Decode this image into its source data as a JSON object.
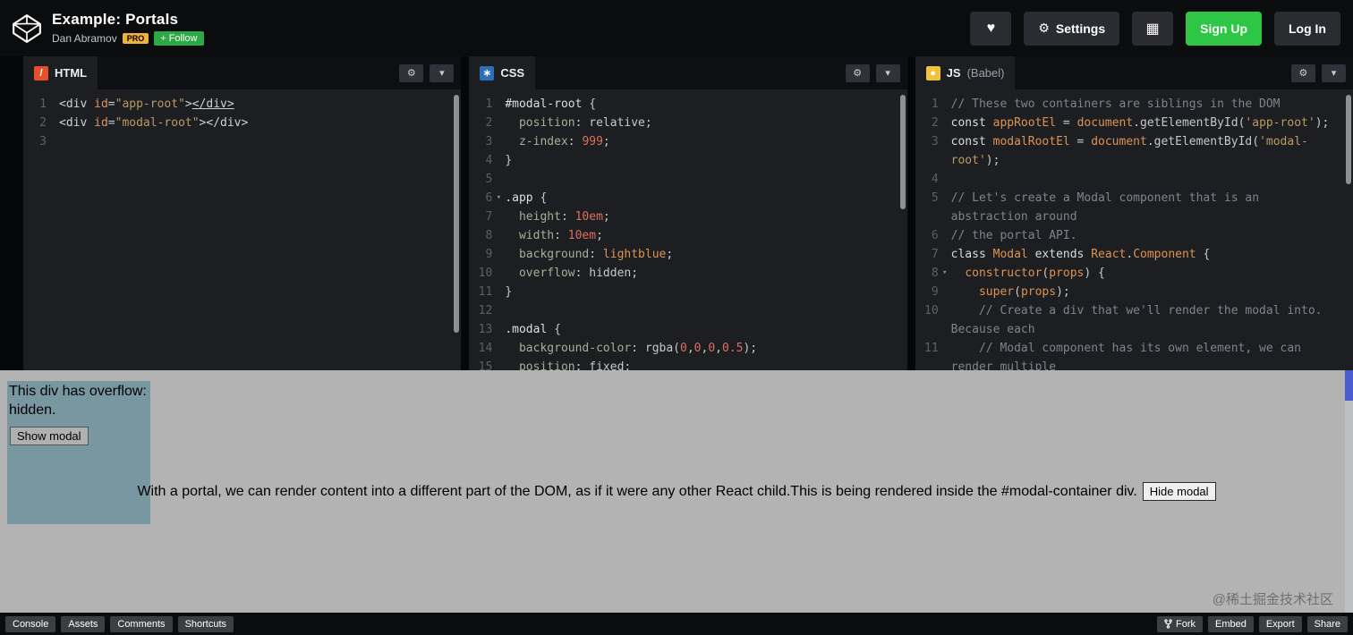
{
  "header": {
    "title": "Example: Portals",
    "author": "Dan Abramov",
    "pro_badge": "PRO",
    "follow_label": "+ Follow",
    "settings_label": "Settings",
    "sign_up_label": "Sign Up",
    "log_in_label": "Log In"
  },
  "icons": {
    "gear": "⚙",
    "chevron": "▾",
    "heart": "♥",
    "grid": "▦",
    "fold": "▾"
  },
  "colors": {
    "accent_green": "#2dc645",
    "follow_green": "#2aa945",
    "pro_gold": "#efb13a",
    "editor_bg": "#1d1e22",
    "preview_bg": "#b3b3b3",
    "app_box": "#7997a1",
    "preview_scroll_thumb": "#4a5ad0"
  },
  "editors": [
    {
      "name": "html",
      "label": "HTML",
      "sublabel": "",
      "icon_char": "/",
      "icon_color": "#e4502e",
      "lines": [
        {
          "num": "1",
          "tokens": [
            [
              "tag",
              "<div"
            ],
            [
              "pln",
              " "
            ],
            [
              "attr",
              "id"
            ],
            [
              "pun",
              "="
            ],
            [
              "str",
              "\"app-root\""
            ],
            [
              "tag",
              ">"
            ],
            [
              "tag u",
              "</div>"
            ]
          ]
        },
        {
          "num": "2",
          "tokens": [
            [
              "tag",
              "<div"
            ],
            [
              "pln",
              " "
            ],
            [
              "attr",
              "id"
            ],
            [
              "pun",
              "="
            ],
            [
              "str",
              "\"modal-root\""
            ],
            [
              "tag",
              ">"
            ],
            [
              "tag",
              "</div>"
            ]
          ]
        },
        {
          "num": "3",
          "tokens": []
        }
      ]
    },
    {
      "name": "css",
      "label": "CSS",
      "sublabel": "",
      "icon_char": "∗",
      "icon_color": "#2e6fba",
      "lines": [
        {
          "num": "1",
          "tokens": [
            [
              "sel",
              "#modal-root"
            ],
            [
              "pln",
              " {"
            ]
          ]
        },
        {
          "num": "2",
          "tokens": [
            [
              "pln",
              "  "
            ],
            [
              "prop",
              "position"
            ],
            [
              "pln",
              ": "
            ],
            [
              "val",
              "relative"
            ],
            [
              "pln",
              ";"
            ]
          ]
        },
        {
          "num": "3",
          "tokens": [
            [
              "pln",
              "  "
            ],
            [
              "prop",
              "z-index"
            ],
            [
              "pln",
              ": "
            ],
            [
              "num",
              "999"
            ],
            [
              "pln",
              ";"
            ]
          ]
        },
        {
          "num": "4",
          "tokens": [
            [
              "pln",
              "}"
            ]
          ]
        },
        {
          "num": "5",
          "tokens": []
        },
        {
          "num": "6",
          "fold": true,
          "tokens": [
            [
              "sel",
              ".app"
            ],
            [
              "pln",
              " {"
            ]
          ]
        },
        {
          "num": "7",
          "tokens": [
            [
              "pln",
              "  "
            ],
            [
              "prop",
              "height"
            ],
            [
              "pln",
              ": "
            ],
            [
              "num",
              "10em"
            ],
            [
              "pln",
              ";"
            ]
          ]
        },
        {
          "num": "8",
          "tokens": [
            [
              "pln",
              "  "
            ],
            [
              "prop",
              "width"
            ],
            [
              "pln",
              ": "
            ],
            [
              "num",
              "10em"
            ],
            [
              "pln",
              ";"
            ]
          ]
        },
        {
          "num": "9",
          "tokens": [
            [
              "pln",
              "  "
            ],
            [
              "prop",
              "background"
            ],
            [
              "pln",
              ": "
            ],
            [
              "id",
              "lightblue"
            ],
            [
              "pln",
              ";"
            ]
          ]
        },
        {
          "num": "10",
          "tokens": [
            [
              "pln",
              "  "
            ],
            [
              "prop",
              "overflow"
            ],
            [
              "pln",
              ": "
            ],
            [
              "val",
              "hidden"
            ],
            [
              "pln",
              ";"
            ]
          ]
        },
        {
          "num": "11",
          "tokens": [
            [
              "pln",
              "}"
            ]
          ]
        },
        {
          "num": "12",
          "tokens": []
        },
        {
          "num": "13",
          "tokens": [
            [
              "sel",
              ".modal"
            ],
            [
              "pln",
              " {"
            ]
          ]
        },
        {
          "num": "14",
          "tokens": [
            [
              "pln",
              "  "
            ],
            [
              "prop",
              "background-color"
            ],
            [
              "pln",
              ": "
            ],
            [
              "pln",
              "rgba("
            ],
            [
              "num",
              "0"
            ],
            [
              "pln",
              ","
            ],
            [
              "num",
              "0"
            ],
            [
              "pln",
              ","
            ],
            [
              "num",
              "0"
            ],
            [
              "pln",
              ","
            ],
            [
              "num",
              "0.5"
            ],
            [
              "pln",
              ");"
            ]
          ]
        },
        {
          "num": "15",
          "tokens": [
            [
              "pln",
              "  "
            ],
            [
              "prop",
              "position"
            ],
            [
              "pln",
              ": "
            ],
            [
              "val",
              "fixed"
            ],
            [
              "pln",
              ";"
            ]
          ]
        }
      ]
    },
    {
      "name": "js",
      "label": "JS",
      "sublabel": "(Babel)",
      "icon_char": "●",
      "icon_color": "#f0c33c",
      "lines": [
        {
          "num": "1",
          "tokens": [
            [
              "cmt",
              "// These two containers are siblings in the DOM"
            ]
          ]
        },
        {
          "num": "2",
          "tokens": [
            [
              "kw",
              "const"
            ],
            [
              "pln",
              " "
            ],
            [
              "id",
              "appRootEl"
            ],
            [
              "pln",
              " = "
            ],
            [
              "id",
              "document"
            ],
            [
              "pln",
              "."
            ],
            [
              "pln",
              "getElementById"
            ],
            [
              "pln",
              "("
            ],
            [
              "str",
              "'app-root'"
            ],
            [
              "pln",
              ");"
            ]
          ]
        },
        {
          "num": "3",
          "tokens": [
            [
              "kw",
              "const"
            ],
            [
              "pln",
              " "
            ],
            [
              "id",
              "modalRootEl"
            ],
            [
              "pln",
              " = "
            ],
            [
              "id",
              "document"
            ],
            [
              "pln",
              "."
            ],
            [
              "pln",
              "getElementById"
            ],
            [
              "pln",
              "("
            ],
            [
              "str",
              "'modal-"
            ]
          ]
        },
        {
          "num": "",
          "tokens": [
            [
              "str",
              "root'"
            ],
            [
              "pln",
              ");"
            ]
          ]
        },
        {
          "num": "4",
          "tokens": []
        },
        {
          "num": "5",
          "tokens": [
            [
              "cmt",
              "// Let's create a Modal component that is an"
            ]
          ]
        },
        {
          "num": "",
          "tokens": [
            [
              "cmt",
              "abstraction around"
            ]
          ]
        },
        {
          "num": "6",
          "tokens": [
            [
              "cmt",
              "// the portal API."
            ]
          ]
        },
        {
          "num": "7",
          "tokens": [
            [
              "kw",
              "class"
            ],
            [
              "pln",
              " "
            ],
            [
              "id",
              "Modal"
            ],
            [
              "pln",
              " "
            ],
            [
              "kw",
              "extends"
            ],
            [
              "pln",
              " "
            ],
            [
              "id",
              "React"
            ],
            [
              "pln",
              "."
            ],
            [
              "id",
              "Component"
            ],
            [
              "pln",
              " {"
            ]
          ]
        },
        {
          "num": "8",
          "fold": true,
          "tokens": [
            [
              "pln",
              "  "
            ],
            [
              "id",
              "constructor"
            ],
            [
              "pln",
              "("
            ],
            [
              "id",
              "props"
            ],
            [
              "pln",
              ") {"
            ]
          ]
        },
        {
          "num": "9",
          "tokens": [
            [
              "pln",
              "    "
            ],
            [
              "id",
              "super"
            ],
            [
              "pln",
              "("
            ],
            [
              "id",
              "props"
            ],
            [
              "pln",
              ");"
            ]
          ]
        },
        {
          "num": "10",
          "tokens": [
            [
              "pln",
              "    "
            ],
            [
              "cmt",
              "// Create a div that we'll render the modal into."
            ]
          ]
        },
        {
          "num": "",
          "tokens": [
            [
              "cmt",
              "Because each"
            ]
          ]
        },
        {
          "num": "11",
          "tokens": [
            [
              "pln",
              "    "
            ],
            [
              "cmt",
              "// Modal component has its own element, we can"
            ]
          ]
        },
        {
          "num": "",
          "tokens": [
            [
              "cmt",
              "render multiple"
            ]
          ]
        }
      ]
    }
  ],
  "preview": {
    "app_text": "This div has overflow: hidden.",
    "show_modal_label": "Show modal",
    "modal_text": "With a portal, we can render content into a different part of the DOM, as if it were any other React child.This is being rendered inside the #modal-container div.",
    "hide_modal_label": "Hide modal"
  },
  "footer": {
    "left": [
      "Console",
      "Assets",
      "Comments",
      "Shortcuts"
    ],
    "right": [
      "Fork",
      "Embed",
      "Export",
      "Share"
    ]
  },
  "watermark": "@稀土掘金技术社区"
}
